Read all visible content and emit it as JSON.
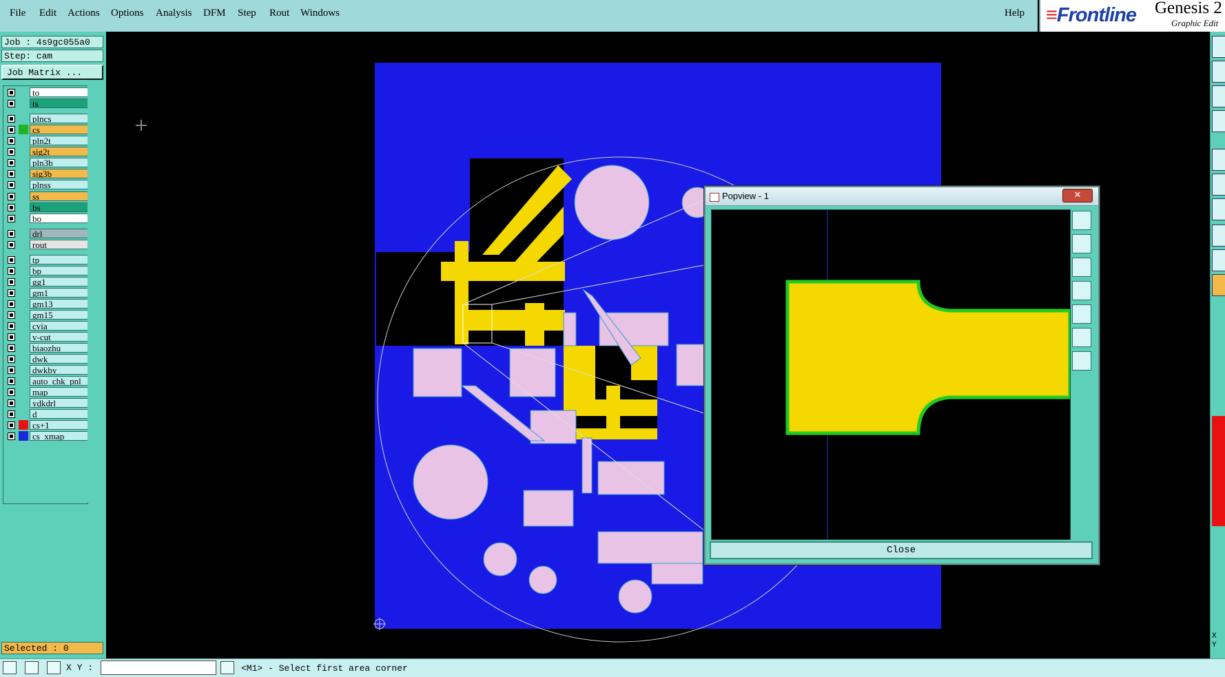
{
  "menu": [
    "File",
    "Edit",
    "Actions",
    "Options",
    "Analysis",
    "DFM",
    "Step",
    "Rout",
    "Windows"
  ],
  "help": "Help",
  "brand": {
    "logo": "Frontline",
    "title": "Genesis 2",
    "subtitle": "Graphic Edit"
  },
  "job": {
    "label": "Job : 4s9gc055a0",
    "step": "Step: cam",
    "matrix_button": "Job Matrix ..."
  },
  "layers": [
    {
      "name": "to",
      "color": "#ffffff",
      "swatch": ""
    },
    {
      "name": "ts",
      "color": "#1aa37a",
      "swatch": ""
    },
    {
      "name": "plncs",
      "color": "#bfeeee",
      "swatch": ""
    },
    {
      "name": "cs",
      "color": "#f2b94b",
      "swatch": "#22b322",
      "active": true
    },
    {
      "name": "pln2t",
      "color": "#bfeeee",
      "swatch": ""
    },
    {
      "name": "sig2t",
      "color": "#f2b94b",
      "swatch": ""
    },
    {
      "name": "pln3b",
      "color": "#bfeeee",
      "swatch": ""
    },
    {
      "name": "sig3b",
      "color": "#f2b94b",
      "swatch": ""
    },
    {
      "name": "plnss",
      "color": "#bfeeee",
      "swatch": ""
    },
    {
      "name": "ss",
      "color": "#f2b94b",
      "swatch": ""
    },
    {
      "name": "bs",
      "color": "#1aa37a",
      "swatch": ""
    },
    {
      "name": "bo",
      "color": "#ffffff",
      "swatch": ""
    },
    {
      "name": "drl",
      "color": "#9fb7bd",
      "swatch": ""
    },
    {
      "name": "rout",
      "color": "#e5e5e5",
      "swatch": ""
    },
    {
      "name": "tp",
      "color": "#bfeeee",
      "swatch": ""
    },
    {
      "name": "bp",
      "color": "#bfeeee",
      "swatch": ""
    },
    {
      "name": "gg1",
      "color": "#bfeeee",
      "swatch": ""
    },
    {
      "name": "gm1",
      "color": "#bfeeee",
      "swatch": ""
    },
    {
      "name": "gm13",
      "color": "#bfeeee",
      "swatch": ""
    },
    {
      "name": "gm15",
      "color": "#bfeeee",
      "swatch": ""
    },
    {
      "name": "cvia",
      "color": "#bfeeee",
      "swatch": ""
    },
    {
      "name": "v-cut",
      "color": "#bfeeee",
      "swatch": ""
    },
    {
      "name": "biaozhu",
      "color": "#bfeeee",
      "swatch": ""
    },
    {
      "name": "dwk",
      "color": "#bfeeee",
      "swatch": ""
    },
    {
      "name": "dwkby",
      "color": "#bfeeee",
      "swatch": ""
    },
    {
      "name": "auto_chk_pnl",
      "color": "#bfeeee",
      "swatch": ""
    },
    {
      "name": "map",
      "color": "#bfeeee",
      "swatch": ""
    },
    {
      "name": "ydkdrl",
      "color": "#bfeeee",
      "swatch": ""
    },
    {
      "name": "d",
      "color": "#bfeeee",
      "swatch": ""
    },
    {
      "name": "cs+1",
      "color": "#bfeeee",
      "swatch": "#e81010"
    },
    {
      "name": "cs_xmap",
      "color": "#bfeeee",
      "swatch": "#1a2ad8"
    }
  ],
  "selected": "Selected : 0",
  "xy_label": "X Y :",
  "status_message": "<M1> - Select first area corner",
  "popview": {
    "title": "Popview - 1",
    "close_button": "Close"
  },
  "right_xy": "X\nY",
  "colors": {
    "board_blue": "#1a1ae6",
    "pad_pink": "#e8c3e6",
    "copper_yellow": "#f5d800",
    "outline_green": "#22cc22",
    "panel_teal": "#5ecfb8",
    "menu_cyan": "#9fd9d9"
  }
}
